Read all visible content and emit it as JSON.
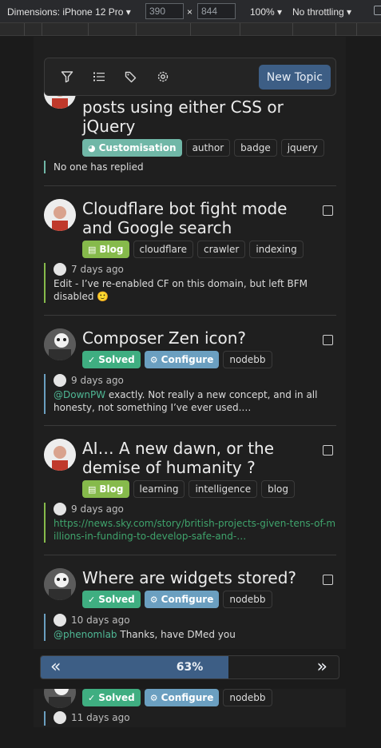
{
  "devtools": {
    "dimensions_label": "Dimensions: iPhone 12 Pro ▾",
    "width": "390",
    "height": "844",
    "times": "×",
    "zoom": "100% ▾",
    "throttling": "No throttling ▾"
  },
  "toolbar": {
    "icons": [
      "filter-icon",
      "list-icon",
      "tags-icon",
      "gear-icon"
    ],
    "new_topic": "New Topic"
  },
  "topics": [
    {
      "title": "posts using either CSS or jQuery",
      "tags": [
        {
          "label": "Customisation",
          "category": true,
          "color": "#70b7a7",
          "icon": "palette-icon"
        },
        {
          "label": "author"
        },
        {
          "label": "badge"
        },
        {
          "label": "jquery"
        }
      ],
      "reply": {
        "text": "No one has replied"
      }
    },
    {
      "title": "Cloudflare bot fight mode and Google search",
      "tags": [
        {
          "label": "Blog",
          "category": true,
          "color": "#86ba4b",
          "icon": "newspaper-icon"
        },
        {
          "label": "cloudflare"
        },
        {
          "label": "crawler"
        },
        {
          "label": "indexing"
        }
      ],
      "reply": {
        "time": "7 days ago",
        "text": "Edit - I’ve re-enabled CF on this domain, but left BFM disabled 🙂",
        "border": "#86ba4b"
      }
    },
    {
      "title": "Composer Zen icon?",
      "tags": [
        {
          "label": "Solved",
          "category": true,
          "color": "#3fae81",
          "icon": "check-icon"
        },
        {
          "label": "Configure",
          "category": true,
          "color": "#6b9fc0",
          "icon": "cogs-icon"
        },
        {
          "label": "nodebb"
        }
      ],
      "reply": {
        "time": "9 days ago",
        "mention": "@DownPW",
        "text": " exactly. Not really a new concept, and in all honesty, not something I’ve ever used.…",
        "border": "#6b9fc0"
      }
    },
    {
      "title": "AI… A new dawn, or the demise of humanity ?",
      "tags": [
        {
          "label": "Blog",
          "category": true,
          "color": "#86ba4b",
          "icon": "newspaper-icon"
        },
        {
          "label": "learning"
        },
        {
          "label": "intelligence"
        },
        {
          "label": "blog"
        }
      ],
      "reply": {
        "time": "9 days ago",
        "link": "https://news.sky.com/story/british-projects-given-tens-of-millions-in-funding-to-develop-safe-and-…",
        "border": "#86ba4b"
      }
    },
    {
      "title": "Where are widgets stored?",
      "tags": [
        {
          "label": "Solved",
          "category": true,
          "color": "#3fae81",
          "icon": "check-icon"
        },
        {
          "label": "Configure",
          "category": true,
          "color": "#6b9fc0",
          "icon": "cogs-icon"
        },
        {
          "label": "nodebb"
        }
      ],
      "reply": {
        "time": "10 days ago",
        "mention": "@phenomlab",
        "text": " Thanks, have DMed you",
        "border": "#6b9fc0"
      }
    },
    {
      "title": "",
      "tags": [
        {
          "label": "Solved",
          "category": true,
          "color": "#3fae81",
          "icon": "check-icon"
        },
        {
          "label": "Configure",
          "category": true,
          "color": "#6b9fc0",
          "icon": "cogs-icon"
        },
        {
          "label": "nodebb"
        }
      ],
      "reply": {
        "time": "11 days ago"
      }
    }
  ],
  "progress": {
    "label": "63%",
    "value": 0.63,
    "prev": "«",
    "next": "»"
  }
}
